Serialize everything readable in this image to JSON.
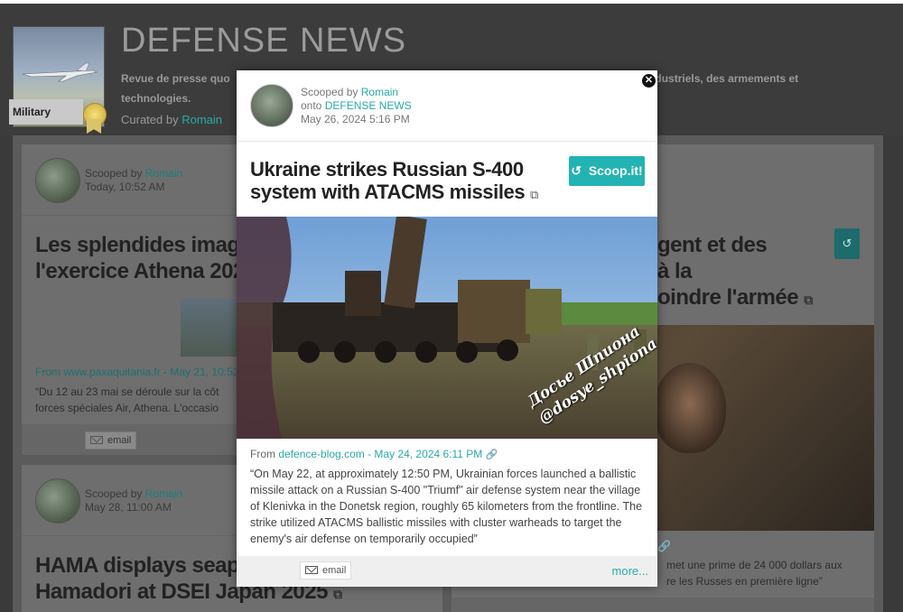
{
  "topic": {
    "title": "DEFENSE NEWS",
    "description": "Revue de presse quotidienne des industriels, des armements et technologies.",
    "description_visible_start": "Revue de presse quo",
    "description_visible_end": "s industriels, des armements et",
    "description_line2": "technologies.",
    "badge": "Military",
    "curated_prefix": "Curated by",
    "curator": "Romain"
  },
  "cards": [
    {
      "scooped_prefix": "Scooped by",
      "curator": "Romain",
      "time": "Today, 10:52 AM",
      "title_line1": "Les splendides images",
      "title_line2": "l'exercice Athena 2025",
      "source": "From www.paxaquitania.fr - May 21, 10:52",
      "snippet_line1": "“Du 12 au 23 mai se déroule sur la côt",
      "snippet_line2": "forces spéciales Air, Athena. L'occasio",
      "email_label": "email"
    },
    {
      "scooped_prefix": "Scooped by",
      "curator": "Romain",
      "time": "May 28, 11:00 AM",
      "title_line1": "HAMA displays seaplar",
      "title_line2": "Hamadori at DSEI Japan 2025"
    },
    {
      "title_line1": "gent et des",
      "title_line2": "à la",
      "title_line3": "oindre l'armée",
      "snippet_line1": "met une prime de 24 000 dollars aux",
      "snippet_line2": "re les Russes en première ligne”"
    }
  ],
  "modal": {
    "scooped_prefix": "Scooped by",
    "curator": "Romain",
    "onto_prefix": "onto",
    "topic": "DEFENSE NEWS",
    "date": "May 26, 2024 5:16 PM",
    "title": "Ukraine strikes Russian S-400 system with ATACMS missiles",
    "scoopit_label": "Scoop.it!",
    "watermark_line1": "Досье Шпиона",
    "watermark_line2": "@dosye_shpiona",
    "source_prefix": "From",
    "source_link": "defence-blog.com - May 24, 2024 6:11 PM",
    "snippet": "“On May 22, at approximately 12:50 PM, Ukrainian forces launched a ballistic missile attack on a Russian S-400 \"Triumf\" air defense system near the village of Klenivka in the Donetsk region, roughly 65 kilometers from the frontline. The strike utilized ATACMS ballistic missiles with cluster warheads to target the enemy's air defense on temporarily occupied”",
    "email_label": "email",
    "more_label": "more..."
  },
  "icons": {
    "close": "close-icon",
    "repost": "repost-icon",
    "external": "external-link-icon",
    "link": "link-icon",
    "email": "envelope-icon"
  },
  "colors": {
    "accent": "#23b3b3",
    "overlay": "#3a3a3a"
  }
}
